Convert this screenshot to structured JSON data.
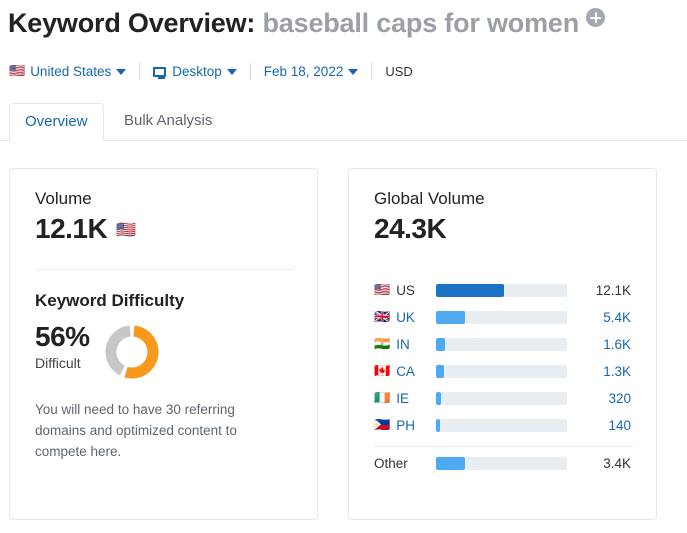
{
  "header": {
    "title_static": "Keyword Overview:",
    "keyword": "baseball caps for women",
    "add_icon": "plus-circle-icon"
  },
  "filters": {
    "country": {
      "flag": "🇺🇸",
      "label": "United States"
    },
    "device": {
      "icon": "desktop-icon",
      "label": "Desktop"
    },
    "date": {
      "label": "Feb 18, 2022"
    },
    "currency": "USD"
  },
  "tabs": [
    {
      "label": "Overview",
      "active": true
    },
    {
      "label": "Bulk Analysis",
      "active": false
    }
  ],
  "volume_card": {
    "label": "Volume",
    "value": "12.1K",
    "flag": "🇺🇸",
    "difficulty": {
      "label": "Keyword Difficulty",
      "percent": "56%",
      "percent_number": 56,
      "rating": "Difficult",
      "note": "You will need to have 30 referring domains and optimized content to compete here.",
      "arc_color": "#f8981d",
      "track_color": "#c7c7c7"
    }
  },
  "global_card": {
    "label": "Global Volume",
    "value": "24.3K"
  },
  "chart_data": {
    "type": "bar",
    "title": "Global Volume",
    "total": "24.3K",
    "total_value": 24300,
    "orientation": "horizontal",
    "categories": [
      "US",
      "UK",
      "IN",
      "CA",
      "IE",
      "PH",
      "Other"
    ],
    "values": [
      12100,
      5400,
      1600,
      1300,
      320,
      140,
      3400
    ],
    "value_labels": [
      "12.1K",
      "5.4K",
      "1.6K",
      "1.3K",
      "320",
      "140",
      "3.4K"
    ],
    "bar_percent": [
      52,
      22,
      7,
      6,
      3.5,
      3,
      22
    ],
    "flags": [
      "🇺🇸",
      "🇬🇧",
      "🇮🇳",
      "🇨🇦",
      "🇮🇪",
      "🇵🇭",
      ""
    ],
    "bar_colors": [
      "#1a73c4",
      "#4daaf0",
      "#4daaf0",
      "#4daaf0",
      "#4daaf0",
      "#4daaf0",
      "#4daaf0"
    ],
    "label_link": [
      false,
      true,
      true,
      true,
      true,
      true,
      false
    ],
    "separator_before_last": true,
    "track_color": "#e8edf2",
    "grid": false,
    "legend": false
  }
}
